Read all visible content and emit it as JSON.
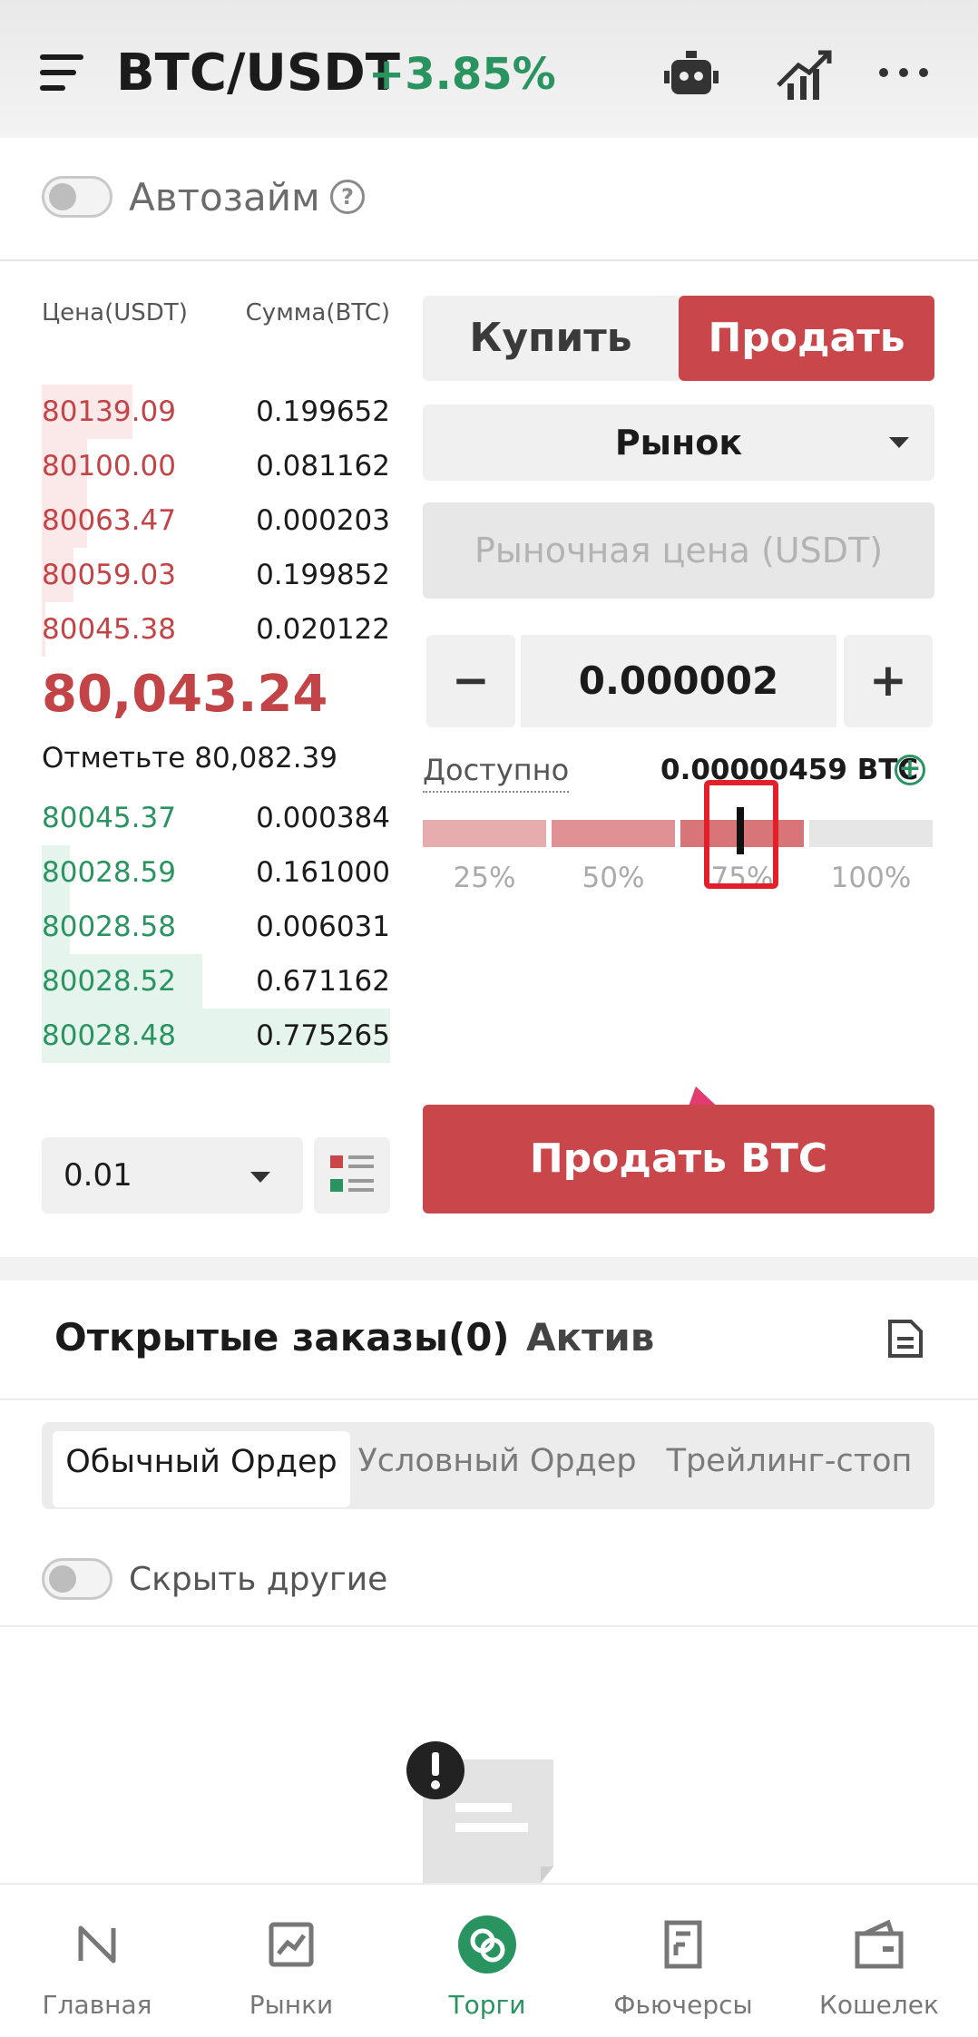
{
  "header": {
    "pair": "BTC/USDT",
    "change": "+3.85%",
    "change_color": "#2a9461",
    "icons": [
      "menu-icon",
      "robot-icon",
      "chart-icon",
      "more-icon"
    ]
  },
  "autoborrow": {
    "label": "Автозайм",
    "enabled": false
  },
  "orderbook": {
    "price_header": "Цена(USDT)",
    "amount_header": "Сумма(BTC)",
    "asks": [
      {
        "price": "80139.09",
        "amount": "0.199652",
        "depth": 0.26
      },
      {
        "price": "80100.00",
        "amount": "0.081162",
        "depth": 0.13
      },
      {
        "price": "80063.47",
        "amount": "0.000203",
        "depth": 0.13
      },
      {
        "price": "80059.03",
        "amount": "0.199852",
        "depth": 0.09
      },
      {
        "price": "80045.38",
        "amount": "0.020122",
        "depth": 0.01
      }
    ],
    "last_price": "80,043.24",
    "mark_price": "Отметьте 80,082.39",
    "bids": [
      {
        "price": "80045.37",
        "amount": "0.000384",
        "depth": 0.0
      },
      {
        "price": "80028.59",
        "amount": "0.161000",
        "depth": 0.08
      },
      {
        "price": "80028.58",
        "amount": "0.006031",
        "depth": 0.08
      },
      {
        "price": "80028.52",
        "amount": "0.671162",
        "depth": 0.46
      },
      {
        "price": "80028.48",
        "amount": "0.775265",
        "depth": 1.0
      }
    ],
    "depth_value": "0.01",
    "ask_color": "#c24447",
    "bid_color": "#2a9461"
  },
  "order_form": {
    "buy_label": "Купить",
    "sell_label": "Продать",
    "selected_side": "sell",
    "order_type": "Рынок",
    "market_price_placeholder": "Рыночная цена (USDT)",
    "quantity": "0.000002",
    "minus": "−",
    "plus": "+",
    "available_label": "Доступно",
    "available_value": "0.00000459 BTC",
    "percent_labels": [
      "25%",
      "50%",
      "75%",
      "100%"
    ],
    "percent_fill": 0.75,
    "submit_label": "Продать BTC",
    "sell_color": "#c9474b"
  },
  "orders": {
    "open_orders_tab": "Открытые заказы(0)",
    "assets_tab": "Актив",
    "subtabs": [
      "Обычный Ордер",
      "Условный Ордер",
      "Трейлинг-стоп"
    ],
    "hide_others_label": "Скрыть другие"
  },
  "bottom_nav": [
    {
      "label": "Главная",
      "icon": "home-icon"
    },
    {
      "label": "Рынки",
      "icon": "markets-icon"
    },
    {
      "label": "Торги",
      "icon": "trade-icon",
      "active": true
    },
    {
      "label": "Фьючерсы",
      "icon": "futures-icon"
    },
    {
      "label": "Кошелек",
      "icon": "wallet-icon"
    }
  ]
}
